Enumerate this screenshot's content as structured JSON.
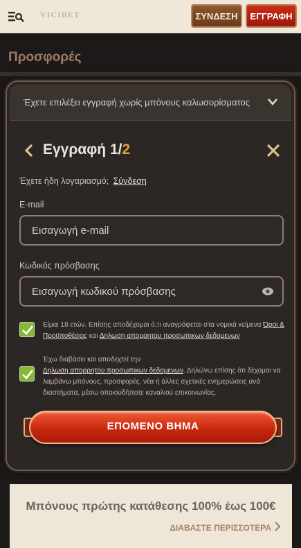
{
  "header": {
    "logo_text": "VICIBET",
    "login_label": "ΣΥΝΔΕΣΗ",
    "register_label": "ΕΓΓΡΑΦΗ"
  },
  "page": {
    "section_title": "Προσφορές",
    "promo_title": "Μπόνους πρώτης κατάθεσης 100% έως 100€",
    "promo_link": "ΔΙΑΒΑΣΤΕ ΠΕΡΙΣΣΟΤΕΡΑ"
  },
  "modal": {
    "bonus_selection": "Έχετε επιλέξει εγγραφή χωρίς μπόνους καλωσορίσματος",
    "title": "Εγγραφή",
    "step_current": "1/",
    "step_total": "2",
    "have_account_text": "Έχετε ήδη λογαριασμό;",
    "login_link": "Σύνδεση",
    "email_label": "E-mail",
    "email_placeholder": "Εισαγωγή e-mail",
    "password_label": "Κωδικός πρόσβασης",
    "password_placeholder": "Εισαγωγή κωδικού πρόσβασης",
    "consent1_text_a": "Είμαι 18 ετών. Επίσης αποδέχομαι ό,τι αναγράφεται στα νομικά κείμενα",
    "consent1_link_terms": "Όροι & Προϋποθέσεις",
    "consent1_and": " και ",
    "consent1_link_privacy": "Δηλωση απορρητου προσωπικων δεδομενων",
    "consent2_text_a": "Έχω διαβάσει και αποδεχτεί την",
    "consent2_link_privacy": "Δηλωση απορρητου προσωπικων δεδομενων",
    "consent2_text_b": ". Δηλώνω επίσης ότι δέχομαι να λαμβάνω μπόνους, προσφορές, νέα ή άλλες σχετικές ενημερώσεις ανά διαστήματα, μέσω οποιουδήποτε καναλιού επικοινωνίας.",
    "next_button": "ΕΠΟΜΕΝΟ ΒΗΜΑ"
  },
  "colors": {
    "accent_orange": "#e59c45",
    "checkbox_green": "#86b735",
    "cta_red": "#c7280f"
  },
  "icons": [
    "menu-search-icon",
    "chevron-down-icon",
    "chevron-left-icon",
    "close-icon",
    "eye-icon",
    "check-icon",
    "chevron-right-icon"
  ]
}
